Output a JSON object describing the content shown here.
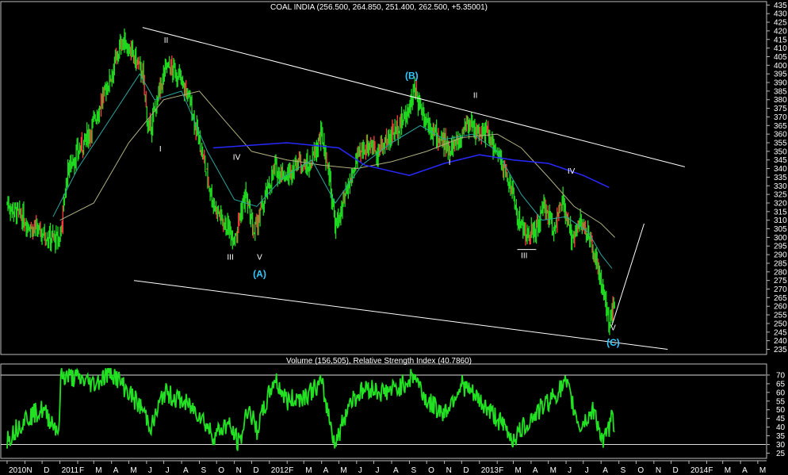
{
  "chart_data": {
    "type": "candlestick",
    "title": "COAL INDIA (256.500, 264.850, 251.400, 262.500, +5.35001)",
    "price": {
      "ylim": [
        232,
        437
      ],
      "yticks": [
        235,
        240,
        245,
        250,
        255,
        260,
        265,
        270,
        275,
        280,
        285,
        290,
        295,
        300,
        305,
        310,
        315,
        320,
        325,
        330,
        335,
        340,
        345,
        350,
        355,
        360,
        365,
        370,
        375,
        380,
        385,
        390,
        395,
        400,
        405,
        410,
        415,
        420,
        425,
        430,
        435
      ],
      "anchors": [
        [
          "2010-10-01",
          320
        ],
        [
          "2010-11-15",
          305
        ],
        [
          "2010-12-31",
          298
        ],
        [
          "2011-01-15",
          340
        ],
        [
          "2011-02-20",
          360
        ],
        [
          "2011-03-10",
          375
        ],
        [
          "2011-04-01",
          395
        ],
        [
          "2011-04-20",
          415
        ],
        [
          "2011-05-10",
          405
        ],
        [
          "2011-05-25",
          395
        ],
        [
          "2011-06-05",
          360
        ],
        [
          "2011-06-20",
          380
        ],
        [
          "2011-07-05",
          400
        ],
        [
          "2011-07-25",
          395
        ],
        [
          "2011-08-15",
          380
        ],
        [
          "2011-09-05",
          350
        ],
        [
          "2011-09-25",
          320
        ],
        [
          "2011-10-15",
          308
        ],
        [
          "2011-11-01",
          300
        ],
        [
          "2011-11-20",
          325
        ],
        [
          "2011-12-05",
          302
        ],
        [
          "2011-12-20",
          318
        ],
        [
          "2012-01-10",
          340
        ],
        [
          "2012-02-01",
          335
        ],
        [
          "2012-02-20",
          345
        ],
        [
          "2012-03-10",
          340
        ],
        [
          "2012-04-01",
          360
        ],
        [
          "2012-04-15",
          335
        ],
        [
          "2012-04-25",
          305
        ],
        [
          "2012-05-10",
          320
        ],
        [
          "2012-06-01",
          345
        ],
        [
          "2012-06-20",
          355
        ],
        [
          "2012-07-10",
          350
        ],
        [
          "2012-08-01",
          360
        ],
        [
          "2012-08-25",
          370
        ],
        [
          "2012-09-10",
          385
        ],
        [
          "2012-09-25",
          372
        ],
        [
          "2012-10-15",
          360
        ],
        [
          "2012-11-05",
          352
        ],
        [
          "2012-11-25",
          355
        ],
        [
          "2012-12-10",
          368
        ],
        [
          "2012-12-25",
          362
        ],
        [
          "2013-01-15",
          360
        ],
        [
          "2013-02-05",
          345
        ],
        [
          "2013-02-25",
          330
        ],
        [
          "2013-03-10",
          310
        ],
        [
          "2013-03-25",
          300
        ],
        [
          "2013-04-10",
          305
        ],
        [
          "2013-04-25",
          318
        ],
        [
          "2013-05-10",
          305
        ],
        [
          "2013-05-25",
          320
        ],
        [
          "2013-06-10",
          300
        ],
        [
          "2013-06-25",
          310
        ],
        [
          "2013-07-10",
          300
        ],
        [
          "2013-07-25",
          285
        ],
        [
          "2013-08-05",
          265
        ],
        [
          "2013-08-15",
          251
        ],
        [
          "2013-08-25",
          262
        ]
      ],
      "ma_blue": [
        [
          "2011-09-25",
          352
        ],
        [
          "2012-02-01",
          355
        ],
        [
          "2012-05-01",
          352
        ],
        [
          "2012-06-15",
          342
        ],
        [
          "2012-09-01",
          336
        ],
        [
          "2012-11-01",
          343
        ],
        [
          "2013-01-01",
          348
        ],
        [
          "2013-03-01",
          345
        ],
        [
          "2013-05-01",
          343
        ],
        [
          "2013-07-01",
          336
        ],
        [
          "2013-08-15",
          329
        ]
      ],
      "ma_olive": [
        [
          "2011-01-01",
          310
        ],
        [
          "2011-03-01",
          320
        ],
        [
          "2011-05-01",
          355
        ],
        [
          "2011-07-01",
          380
        ],
        [
          "2011-09-01",
          385
        ],
        [
          "2011-10-15",
          368
        ],
        [
          "2011-12-01",
          350
        ],
        [
          "2012-02-01",
          345
        ],
        [
          "2012-04-01",
          342
        ],
        [
          "2012-06-01",
          340
        ],
        [
          "2012-08-01",
          344
        ],
        [
          "2012-10-01",
          350
        ],
        [
          "2012-12-01",
          358
        ],
        [
          "2013-02-01",
          360
        ],
        [
          "2013-03-15",
          352
        ],
        [
          "2013-05-01",
          335
        ],
        [
          "2013-06-15",
          318
        ],
        [
          "2013-08-01",
          308
        ],
        [
          "2013-08-25",
          300
        ]
      ],
      "ma_teal": [
        [
          "2010-12-20",
          312
        ],
        [
          "2011-02-01",
          340
        ],
        [
          "2011-04-01",
          370
        ],
        [
          "2011-05-20",
          395
        ],
        [
          "2011-06-15",
          380
        ],
        [
          "2011-08-01",
          385
        ],
        [
          "2011-09-15",
          350
        ],
        [
          "2011-11-01",
          322
        ],
        [
          "2011-12-10",
          318
        ],
        [
          "2012-01-25",
          335
        ],
        [
          "2012-03-15",
          345
        ],
        [
          "2012-04-25",
          320
        ],
        [
          "2012-06-10",
          342
        ],
        [
          "2012-08-01",
          355
        ],
        [
          "2012-09-20",
          365
        ],
        [
          "2012-11-01",
          357
        ],
        [
          "2012-12-20",
          360
        ],
        [
          "2013-02-01",
          350
        ],
        [
          "2013-03-15",
          325
        ],
        [
          "2013-04-20",
          310
        ],
        [
          "2013-06-01",
          312
        ],
        [
          "2013-07-10",
          303
        ],
        [
          "2013-08-01",
          290
        ],
        [
          "2013-08-20",
          282
        ]
      ],
      "channel_upper": [
        [
          "2011-05-25",
          422
        ],
        [
          "2013-12-25",
          341
        ]
      ],
      "channel_lower": [
        [
          "2011-05-10",
          275
        ],
        [
          "2013-11-25",
          235
        ]
      ],
      "projection": [
        [
          "2013-08-20",
          249
        ],
        [
          "2013-10-15",
          308
        ]
      ],
      "hline_bottom": [
        [
          "2013-03-08",
          293
        ],
        [
          "2013-04-10",
          293
        ]
      ],
      "wave_labels": [
        {
          "label": "II",
          "date": "2011-07-05",
          "value": 413
        },
        {
          "label": "I",
          "date": "2011-06-25",
          "value": 350
        },
        {
          "label": "IV",
          "date": "2011-11-05",
          "value": 345
        },
        {
          "label": "III",
          "date": "2011-10-25",
          "value": 287
        },
        {
          "label": "V",
          "date": "2011-12-15",
          "value": 287
        },
        {
          "label": "(A)",
          "date": "2011-12-15",
          "value": 277,
          "major": true
        },
        {
          "label": "(B)",
          "date": "2012-09-05",
          "value": 392,
          "major": true
        },
        {
          "label": "II",
          "date": "2012-12-25",
          "value": 381
        },
        {
          "label": "I",
          "date": "2012-11-10",
          "value": 342
        },
        {
          "label": "IV",
          "date": "2013-06-10",
          "value": 337
        },
        {
          "label": "III",
          "date": "2013-03-20",
          "value": 288
        },
        {
          "label": "V",
          "date": "2013-08-22",
          "value": 246
        },
        {
          "label": "(C)",
          "date": "2013-08-22",
          "value": 237,
          "major": true
        }
      ]
    },
    "indicator": {
      "title": "Volume (156,505), Relative Strength Index (40.7860)",
      "name": "Relative Strength Index",
      "ylim": [
        22,
        75
      ],
      "yticks": [
        25,
        30,
        35,
        40,
        45,
        50,
        55,
        60,
        65,
        70
      ],
      "levels": [
        30,
        70
      ],
      "anchors": [
        [
          "2010-10-01",
          33
        ],
        [
          "2010-11-01",
          45
        ],
        [
          "2010-12-01",
          50
        ],
        [
          "2010-12-31",
          38
        ],
        [
          "2011-01-02",
          70
        ],
        [
          "2011-02-01",
          68
        ],
        [
          "2011-03-01",
          65
        ],
        [
          "2011-04-01",
          72
        ],
        [
          "2011-05-01",
          60
        ],
        [
          "2011-05-25",
          50
        ],
        [
          "2011-06-10",
          40
        ],
        [
          "2011-07-01",
          60
        ],
        [
          "2011-08-01",
          55
        ],
        [
          "2011-09-01",
          48
        ],
        [
          "2011-09-25",
          35
        ],
        [
          "2011-10-20",
          42
        ],
        [
          "2011-11-10",
          30
        ],
        [
          "2011-11-25",
          52
        ],
        [
          "2011-12-10",
          38
        ],
        [
          "2012-01-10",
          68
        ],
        [
          "2012-02-01",
          55
        ],
        [
          "2012-03-01",
          58
        ],
        [
          "2012-04-01",
          65
        ],
        [
          "2012-04-25",
          30
        ],
        [
          "2012-05-20",
          55
        ],
        [
          "2012-06-20",
          63
        ],
        [
          "2012-07-15",
          60
        ],
        [
          "2012-08-10",
          62
        ],
        [
          "2012-09-10",
          70
        ],
        [
          "2012-10-01",
          55
        ],
        [
          "2012-11-01",
          48
        ],
        [
          "2012-12-01",
          65
        ],
        [
          "2013-01-01",
          55
        ],
        [
          "2013-02-01",
          45
        ],
        [
          "2013-03-01",
          33
        ],
        [
          "2013-04-01",
          45
        ],
        [
          "2013-05-01",
          55
        ],
        [
          "2013-06-01",
          65
        ],
        [
          "2013-06-25",
          40
        ],
        [
          "2013-07-20",
          50
        ],
        [
          "2013-08-05",
          30
        ],
        [
          "2013-08-20",
          45
        ],
        [
          "2013-08-25",
          41
        ]
      ]
    },
    "x_axis": {
      "labels": [
        {
          "date": "2010-10-01",
          "text": "2010"
        },
        {
          "date": "2010-11-01",
          "text": "N"
        },
        {
          "date": "2010-12-01",
          "text": "D"
        },
        {
          "date": "2011-01-01",
          "text": "2011"
        },
        {
          "date": "2011-02-01",
          "text": "F"
        },
        {
          "date": "2011-03-01",
          "text": "M"
        },
        {
          "date": "2011-04-01",
          "text": "A"
        },
        {
          "date": "2011-05-01",
          "text": "M"
        },
        {
          "date": "2011-06-01",
          "text": "J"
        },
        {
          "date": "2011-07-01",
          "text": "J"
        },
        {
          "date": "2011-08-01",
          "text": "A"
        },
        {
          "date": "2011-09-01",
          "text": "S"
        },
        {
          "date": "2011-10-01",
          "text": "O"
        },
        {
          "date": "2011-11-01",
          "text": "N"
        },
        {
          "date": "2011-12-01",
          "text": "D"
        },
        {
          "date": "2012-01-01",
          "text": "2012"
        },
        {
          "date": "2012-02-01",
          "text": "F"
        },
        {
          "date": "2012-03-01",
          "text": "M"
        },
        {
          "date": "2012-04-01",
          "text": "A"
        },
        {
          "date": "2012-05-01",
          "text": "M"
        },
        {
          "date": "2012-06-01",
          "text": "J"
        },
        {
          "date": "2012-07-01",
          "text": "J"
        },
        {
          "date": "2012-08-01",
          "text": "A"
        },
        {
          "date": "2012-09-01",
          "text": "S"
        },
        {
          "date": "2012-10-01",
          "text": "O"
        },
        {
          "date": "2012-11-01",
          "text": "N"
        },
        {
          "date": "2012-12-01",
          "text": "D"
        },
        {
          "date": "2013-01-01",
          "text": "2013"
        },
        {
          "date": "2013-02-01",
          "text": "F"
        },
        {
          "date": "2013-03-01",
          "text": "M"
        },
        {
          "date": "2013-04-01",
          "text": "A"
        },
        {
          "date": "2013-05-01",
          "text": "M"
        },
        {
          "date": "2013-06-01",
          "text": "J"
        },
        {
          "date": "2013-07-01",
          "text": "J"
        },
        {
          "date": "2013-08-01",
          "text": "A"
        },
        {
          "date": "2013-09-01",
          "text": "S"
        },
        {
          "date": "2013-10-01",
          "text": "O"
        },
        {
          "date": "2013-11-01",
          "text": "N"
        },
        {
          "date": "2013-12-01",
          "text": "D"
        },
        {
          "date": "2014-01-01",
          "text": "2014"
        },
        {
          "date": "2014-02-01",
          "text": "F"
        },
        {
          "date": "2014-03-01",
          "text": "M"
        },
        {
          "date": "2014-04-01",
          "text": "A"
        },
        {
          "date": "2014-05-01",
          "text": "M"
        }
      ]
    },
    "colors": {
      "background": "#000000",
      "candle": "#1fd81f",
      "candle_down": "#ff3b3b",
      "rsi": "#22e022",
      "ma_blue": "#2828ff",
      "ma_olive": "#b0b080",
      "ma_teal": "#2aa6a0",
      "line": "#ffffff",
      "major_label": "#33c8ff"
    }
  }
}
